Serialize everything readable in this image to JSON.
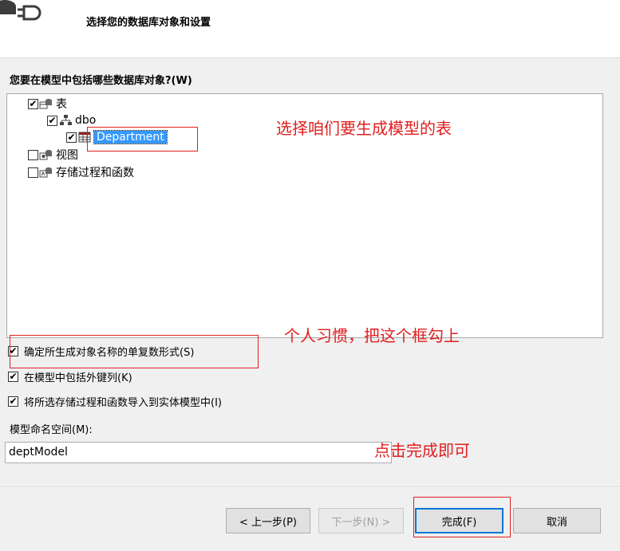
{
  "header": {
    "title": "选择您的数据库对象和设置"
  },
  "question": "您要在模型中包括哪些数据库对象?(W)",
  "tree": [
    {
      "label": "表",
      "checked": "✔"
    },
    {
      "label": "dbo",
      "checked": "✔"
    },
    {
      "label": "Department",
      "checked": "✔"
    },
    {
      "label": "视图",
      "checked": ""
    },
    {
      "label": "存储过程和函数",
      "checked": ""
    }
  ],
  "options": [
    {
      "label": "确定所生成对象名称的单复数形式(S)",
      "checked": "✔"
    },
    {
      "label": "在模型中包括外键列(K)",
      "checked": "✔"
    },
    {
      "label": "将所选存储过程和函数导入到实体模型中(I)",
      "checked": "✔"
    }
  ],
  "namespace": {
    "label": "模型命名空间(M):",
    "value": "deptModel"
  },
  "buttons": {
    "prev": "< 上一步(P)",
    "next": "下一步(N) >",
    "finish": "完成(F)",
    "cancel": "取消"
  },
  "annotations": {
    "table_note": "选择咱们要生成模型的表",
    "habit_note": "个人习惯，把这个框勾上",
    "finish_note": "点击完成即可"
  },
  "colors": {
    "annotation": "#e02020",
    "selection": "#3399ff",
    "primary_border": "#0078d7"
  }
}
